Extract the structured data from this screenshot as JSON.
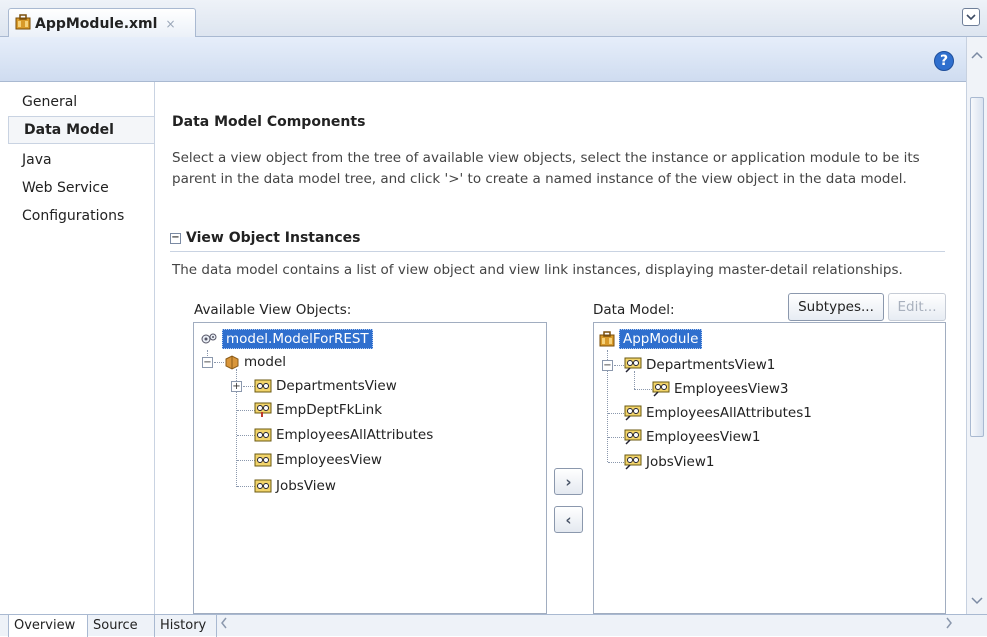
{
  "file_tab": {
    "label": "AppModule.xml",
    "close_glyph": "×"
  },
  "toolbar": {
    "help_label": "?"
  },
  "nav": {
    "items": [
      {
        "label": "General"
      },
      {
        "label": "Data Model"
      },
      {
        "label": "Java"
      },
      {
        "label": "Web Service"
      },
      {
        "label": "Configurations"
      }
    ],
    "active": "Data Model"
  },
  "main": {
    "title": "Data Model Components",
    "description": "Select a view object from the tree of available view objects, select the instance or application module to be its parent in the data model tree, and click '>' to create a named instance of the view object in the data model.",
    "voi": {
      "title": "View Object Instances",
      "collapse_glyph": "−",
      "description": "The data model contains a list of view object and view link instances, displaying master-detail relationships."
    },
    "available": {
      "label": "Available View Objects:",
      "tree": {
        "root": "model.ModelForREST",
        "package": "model",
        "items": [
          "DepartmentsView",
          "EmpDeptFkLink",
          "EmployeesAllAttributes",
          "EmployeesView",
          "JobsView"
        ]
      }
    },
    "data_model": {
      "label": "Data Model:",
      "subtypes_button": "Subtypes...",
      "edit_button": "Edit...",
      "tree": {
        "root": "AppModule",
        "department": "DepartmentsView1",
        "child": "EmployeesView3",
        "items": [
          "EmployeesAllAttributes1",
          "EmployeesView1",
          "JobsView1"
        ]
      }
    },
    "add_button": "›",
    "remove_button": "‹"
  },
  "bottom_tabs": [
    {
      "label": "Overview"
    },
    {
      "label": "Source"
    },
    {
      "label": "History"
    }
  ],
  "colors": {
    "selection": "#2f6fce",
    "header_gradient": "#cfdcf0"
  }
}
